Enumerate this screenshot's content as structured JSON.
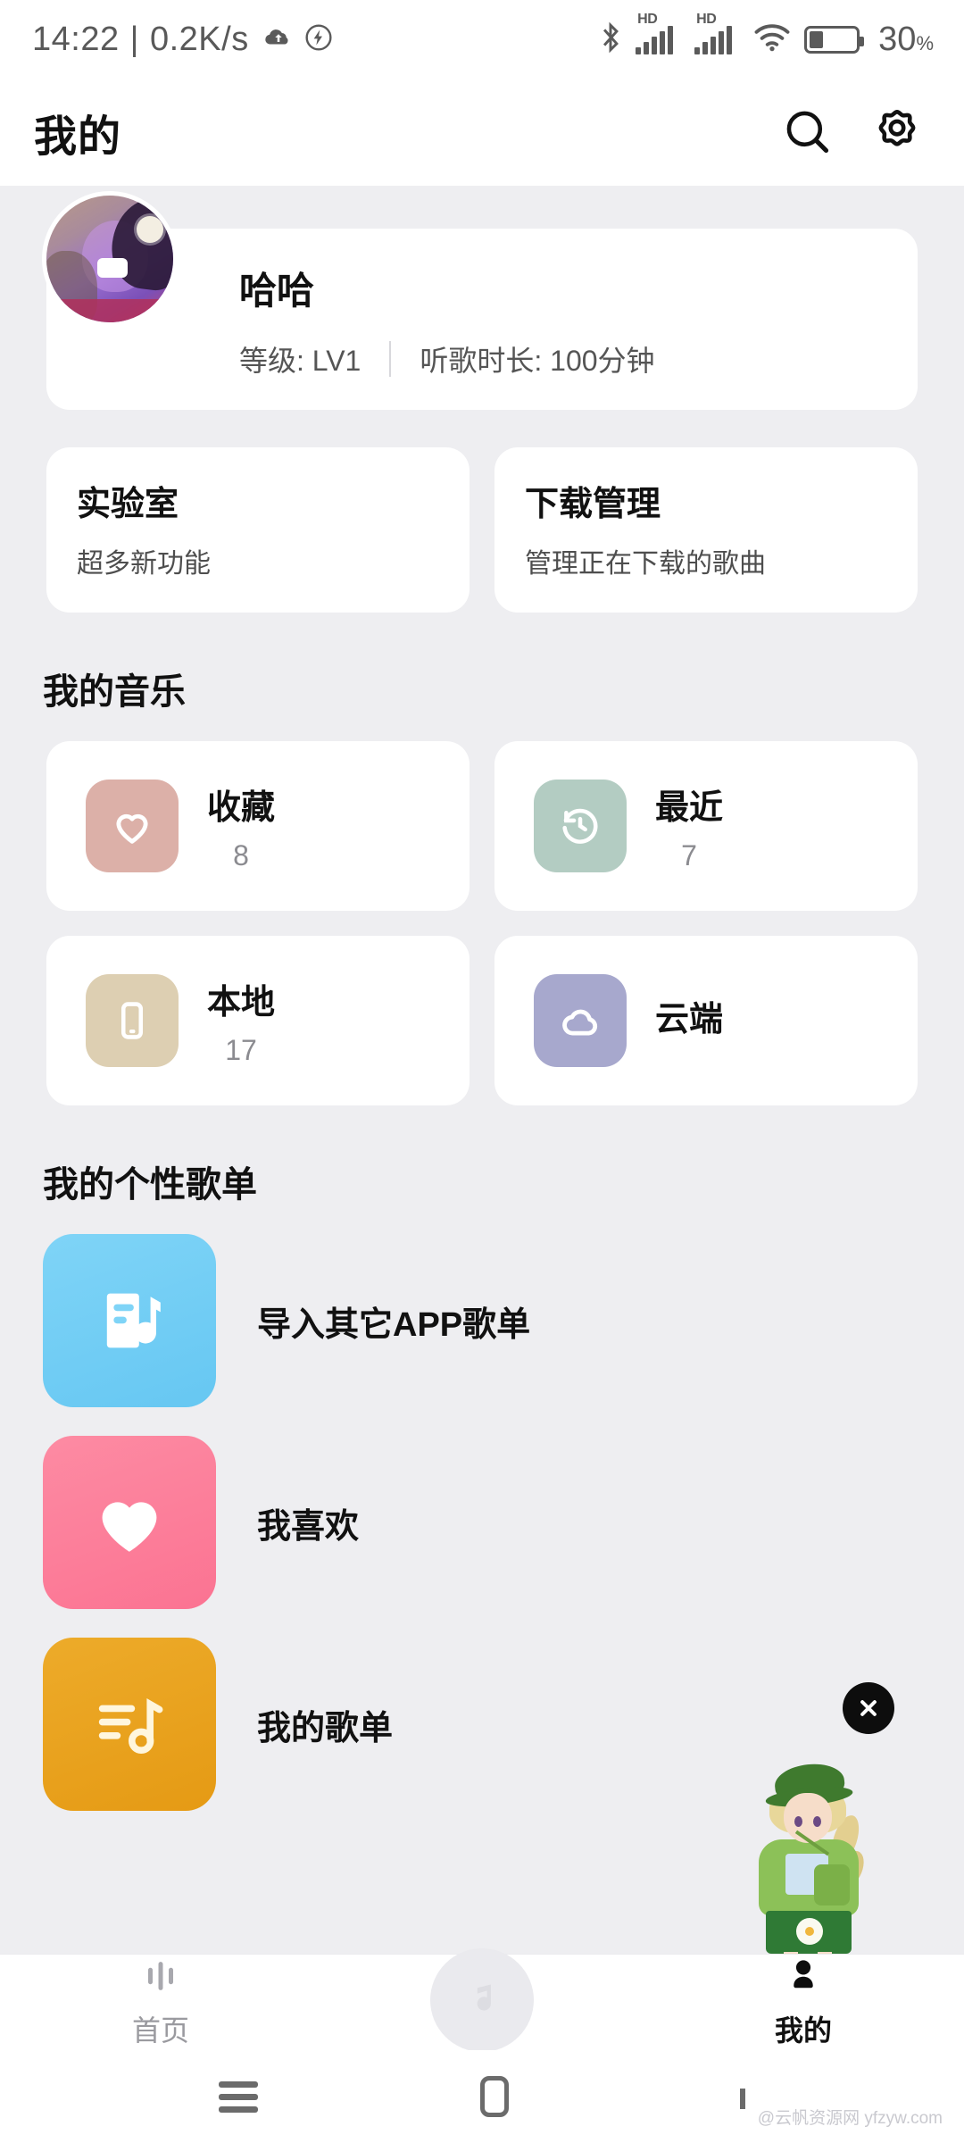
{
  "status_bar": {
    "time": "14:22",
    "separator": "|",
    "network_speed": "0.2K/s",
    "icons": [
      "cloud-upload-icon",
      "flash-charge-icon",
      "bluetooth-icon",
      "hd-signal-icon",
      "hd-signal-icon-2",
      "wifi-icon",
      "battery-icon"
    ],
    "hd_label": "HD",
    "battery_percent": "30",
    "battery_percent_symbol": "%",
    "battery_level": 30
  },
  "header": {
    "title": "我的",
    "search_icon": "search-icon",
    "settings_icon": "gear-icon"
  },
  "profile": {
    "name": "哈哈",
    "level_label": "等级: LV1",
    "listen_time_label": "听歌时长: 100分钟"
  },
  "features": [
    {
      "title": "实验室",
      "subtitle": "超多新功能"
    },
    {
      "title": "下载管理",
      "subtitle": "管理正在下载的歌曲"
    }
  ],
  "my_music": {
    "section_title": "我的音乐",
    "items": [
      {
        "title": "收藏",
        "count": "8",
        "icon": "heart-outline-icon",
        "color": "#dcb0a8"
      },
      {
        "title": "最近",
        "count": "7",
        "icon": "clock-history-icon",
        "color": "#b3ccc2"
      },
      {
        "title": "本地",
        "count": "17",
        "icon": "phone-icon",
        "color": "#ddcfb2"
      },
      {
        "title": "云端",
        "count": "",
        "icon": "cloud-icon",
        "color": "#a7a8cd"
      }
    ]
  },
  "playlists": {
    "section_title": "我的个性歌单",
    "items": [
      {
        "label": "导入其它APP歌单",
        "icon": "import-playlist-icon",
        "color": "#6ccdf5"
      },
      {
        "label": "我喜欢",
        "icon": "heart-filled-icon",
        "color": "#fb7f98"
      },
      {
        "label": "我的歌单",
        "icon": "playlist-music-icon",
        "color": "#e9a420"
      }
    ]
  },
  "floating_widget": {
    "close_icon": "close-icon",
    "character": "avatar-character-image"
  },
  "tabbar": {
    "items": [
      {
        "label": "首页",
        "icon": "equalizer-icon",
        "active": false
      },
      {
        "label": "",
        "icon": "music-note-icon",
        "active": false
      },
      {
        "label": "我的",
        "icon": "person-icon",
        "active": true
      }
    ]
  },
  "android_nav": {
    "menu_icon": "menu-icon",
    "home_icon": "home-icon",
    "back_icon": "back-icon"
  },
  "watermark": "@云帆资源网 yfzyw.com"
}
